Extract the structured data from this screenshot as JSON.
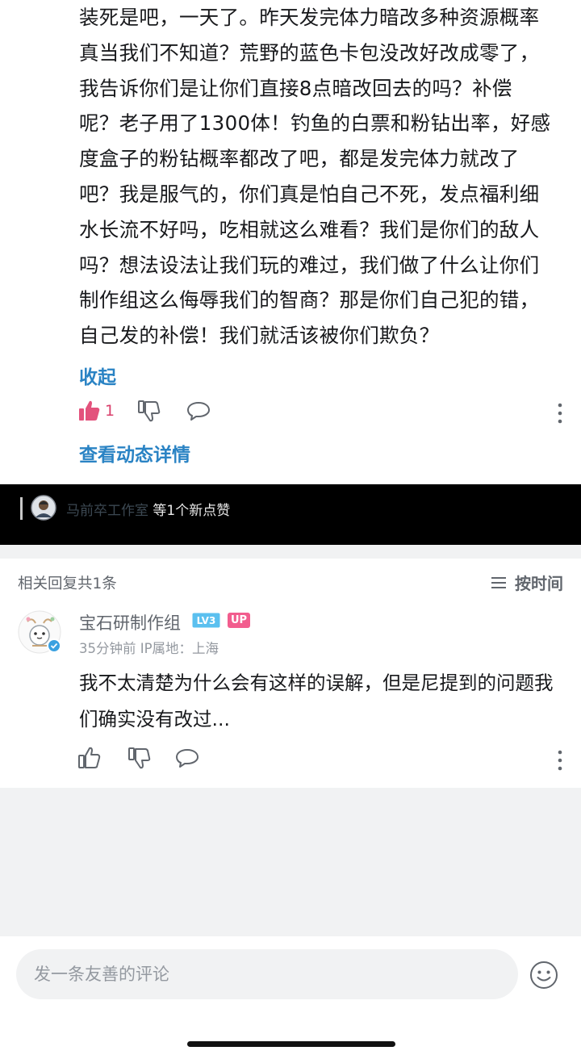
{
  "post": {
    "lines": [
      "装死是吧，一天了。昨天发完体力暗改多种资源概率",
      "真当我们不知道？荒野的蓝色卡包没改好改成零了，",
      "我告诉你们是让你们直接8点暗改回去的吗？补偿",
      "呢？老子用了1300体！钓鱼的白票和粉钻出率，好感",
      "度盒子的粉钻概率都改了吧，都是发完体力就改了",
      "吧？我是服气的，你们真是怕自己不死，发点福利细",
      "水长流不好吗，吃相就这么难看？我们是你们的敌人",
      "吗？想法设法让我们玩的难过，我们做了什么让你们",
      "制作组这么侮辱我们的智商？那是你们自己犯的错，",
      "自己发的补偿！我们就活该被你们欺负？"
    ],
    "collapse_label": "收起",
    "like_count": "1",
    "detail_label": "查看动态详情"
  },
  "notice": {
    "who": "马前卒工作室",
    "text": " 等1个新点赞"
  },
  "replies": {
    "count_label": "相关回复共1条",
    "sort_label": "按时间"
  },
  "comment": {
    "username": "宝石研制作组",
    "level": "LV3",
    "up_badge": "UP",
    "meta": "35分钟前  IP属地：上海",
    "text": "我不太清楚为什么会有这样的误解，但是尼提到的问题我们确实没有改过..."
  },
  "input": {
    "placeholder": "发一条友善的评论"
  },
  "colors": {
    "link": "#2a83c4",
    "like_active": "#d9406c",
    "up_badge": "#f25d8e",
    "level_badge": "#5bc0ef"
  },
  "icons": [
    "thumbs-up-icon",
    "thumbs-down-icon",
    "comment-icon",
    "more-icon",
    "sort-icon",
    "emoji-icon",
    "verified-icon"
  ]
}
